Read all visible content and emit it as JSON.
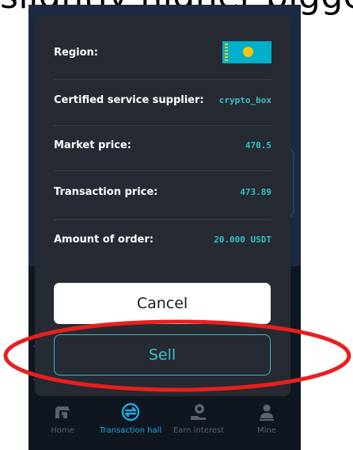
{
  "caption": {
    "text": "slightly higher bigge"
  },
  "modal": {
    "rows": [
      {
        "label": "Region:",
        "value": ""
      },
      {
        "label": "Certified service supplier:",
        "value": "crypto_box"
      },
      {
        "label": "Market price:",
        "value": "470.5"
      },
      {
        "label": "Transaction price:",
        "value": "473.89"
      },
      {
        "label": "Amount of order:",
        "value": "20.000 USDT"
      }
    ],
    "flag": {
      "icon": "kazakhstan-flag-icon",
      "colors": {
        "field": "#00afca",
        "sun": "#fec50c"
      }
    },
    "cancel_label": "Cancel",
    "sell_label": "Sell"
  },
  "tabs": [
    {
      "label": "Home",
      "icon": "home-g-icon"
    },
    {
      "label": "Transaction hall",
      "icon": "exchange-icon",
      "active": true
    },
    {
      "label": "Earn interest",
      "icon": "coin-hand-icon"
    },
    {
      "label": "Mine",
      "icon": "user-icon"
    }
  ],
  "annotation": {
    "shape": "ellipse",
    "color": "#e8201e"
  },
  "colors": {
    "accent": "#3fc3c6",
    "modal_bg": "#262a33",
    "tab_active": "#23a8e0"
  }
}
